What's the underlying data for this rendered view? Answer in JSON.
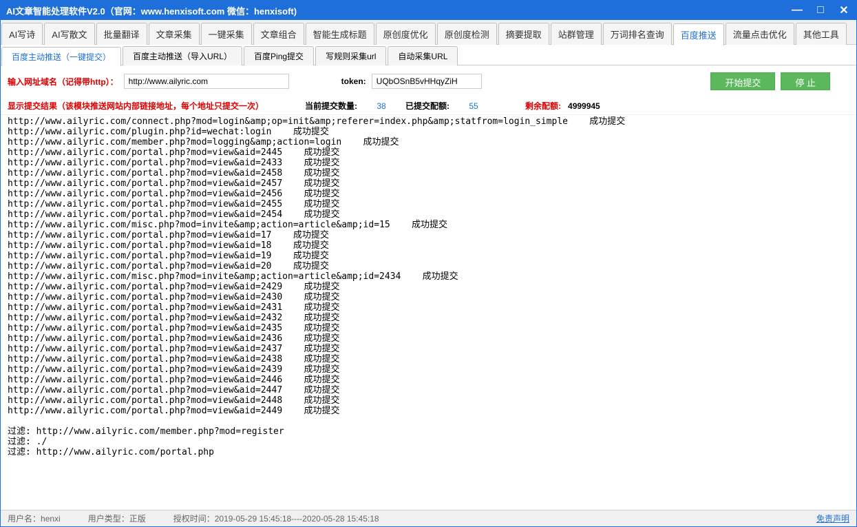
{
  "title": "AI文章智能处理软件V2.0（官网：www.henxisoft.com  微信：henxisoft)",
  "main_tabs": [
    "AI写诗",
    "AI写散文",
    "批量翻译",
    "文章采集",
    "一键采集",
    "文章组合",
    "智能生成标题",
    "原创度优化",
    "原创度检测",
    "摘要提取",
    "站群管理",
    "万词排名查询",
    "百度推送",
    "流量点击优化",
    "其他工具"
  ],
  "main_tab_active": 12,
  "sub_tabs": [
    "百度主动推送（一键提交）",
    "百度主动推送（导入URL）",
    "百度Ping提交",
    "写规则采集url",
    "自动采集URL"
  ],
  "sub_tab_active": 0,
  "form": {
    "url_label": "输入网址域名（记得带http）：",
    "url_value": "http://www.ailyric.com",
    "token_label": "token:",
    "token_value": "UQbOSnB5vHHqyZiH",
    "start_btn": "开始提交",
    "stop_btn": "停 止"
  },
  "stats": {
    "result_label": "显示提交结果（该模块推送网站内部链接地址，每个地址只提交一次）",
    "current_label": "当前提交数量:",
    "current_value": "38",
    "submitted_label": "已提交配额:",
    "submitted_value": "55",
    "remain_label": "剩余配额:",
    "remain_value": "4999945"
  },
  "log_lines": [
    "http://www.ailyric.com/connect.php?mod=login&amp;op=init&amp;referer=index.php&amp;statfrom=login_simple    成功提交",
    "http://www.ailyric.com/plugin.php?id=wechat:login    成功提交",
    "http://www.ailyric.com/member.php?mod=logging&amp;action=login    成功提交",
    "http://www.ailyric.com/portal.php?mod=view&aid=2445    成功提交",
    "http://www.ailyric.com/portal.php?mod=view&aid=2433    成功提交",
    "http://www.ailyric.com/portal.php?mod=view&aid=2458    成功提交",
    "http://www.ailyric.com/portal.php?mod=view&aid=2457    成功提交",
    "http://www.ailyric.com/portal.php?mod=view&aid=2456    成功提交",
    "http://www.ailyric.com/portal.php?mod=view&aid=2455    成功提交",
    "http://www.ailyric.com/portal.php?mod=view&aid=2454    成功提交",
    "http://www.ailyric.com/misc.php?mod=invite&amp;action=article&amp;id=15    成功提交",
    "http://www.ailyric.com/portal.php?mod=view&aid=17    成功提交",
    "http://www.ailyric.com/portal.php?mod=view&aid=18    成功提交",
    "http://www.ailyric.com/portal.php?mod=view&aid=19    成功提交",
    "http://www.ailyric.com/portal.php?mod=view&aid=20    成功提交",
    "http://www.ailyric.com/misc.php?mod=invite&amp;action=article&amp;id=2434    成功提交",
    "http://www.ailyric.com/portal.php?mod=view&aid=2429    成功提交",
    "http://www.ailyric.com/portal.php?mod=view&aid=2430    成功提交",
    "http://www.ailyric.com/portal.php?mod=view&aid=2431    成功提交",
    "http://www.ailyric.com/portal.php?mod=view&aid=2432    成功提交",
    "http://www.ailyric.com/portal.php?mod=view&aid=2435    成功提交",
    "http://www.ailyric.com/portal.php?mod=view&aid=2436    成功提交",
    "http://www.ailyric.com/portal.php?mod=view&aid=2437    成功提交",
    "http://www.ailyric.com/portal.php?mod=view&aid=2438    成功提交",
    "http://www.ailyric.com/portal.php?mod=view&aid=2439    成功提交",
    "http://www.ailyric.com/portal.php?mod=view&aid=2446    成功提交",
    "http://www.ailyric.com/portal.php?mod=view&aid=2447    成功提交",
    "http://www.ailyric.com/portal.php?mod=view&aid=2448    成功提交",
    "http://www.ailyric.com/portal.php?mod=view&aid=2449    成功提交",
    "",
    "过滤: http://www.ailyric.com/member.php?mod=register",
    "过滤: ./",
    "过滤: http://www.ailyric.com/portal.php"
  ],
  "status": {
    "user_label": "用户名：",
    "user_value": "henxi",
    "type_label": "用户类型：",
    "type_value": "正版",
    "auth_label": "授权时间：",
    "auth_value": "2019-05-29 15:45:18----2020-05-28 15:45:18",
    "disclaimer": "免责声明"
  }
}
